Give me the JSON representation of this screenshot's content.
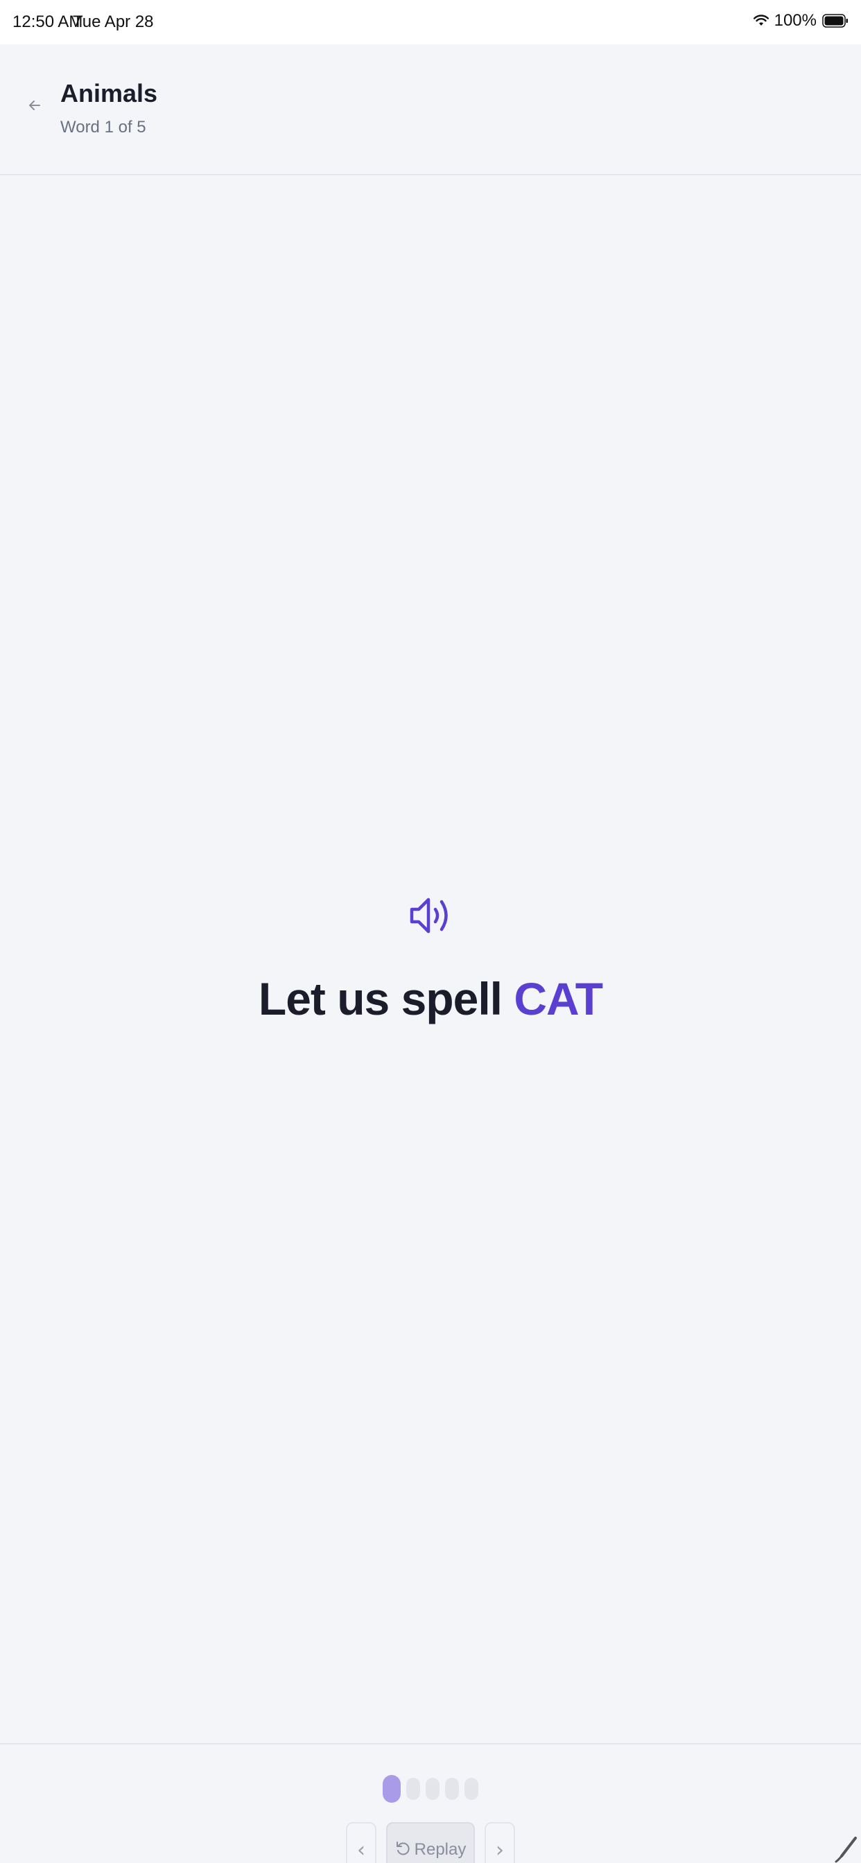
{
  "status_bar": {
    "time": "12:50 AM",
    "date": "Tue Apr 28",
    "battery": "100%",
    "icons": [
      "wifi-icon",
      "battery-icon"
    ]
  },
  "header": {
    "title": "Animals",
    "subtitle": "Word 1 of 5",
    "back_icon": "arrow-left-icon"
  },
  "main": {
    "speaker_icon": "speaker-icon",
    "prompt_prefix": "Let us spell ",
    "word": "CAT"
  },
  "footer": {
    "progress": {
      "current": 1,
      "total": 5
    },
    "prev_label": "‹",
    "next_label": "›",
    "replay_label": "Replay",
    "replay_icon": "replay-icon"
  },
  "colors": {
    "accent": "#5b3fd1",
    "accent_light": "#a99be8",
    "background": "#f4f5f9",
    "text": "#1c1d2a"
  }
}
